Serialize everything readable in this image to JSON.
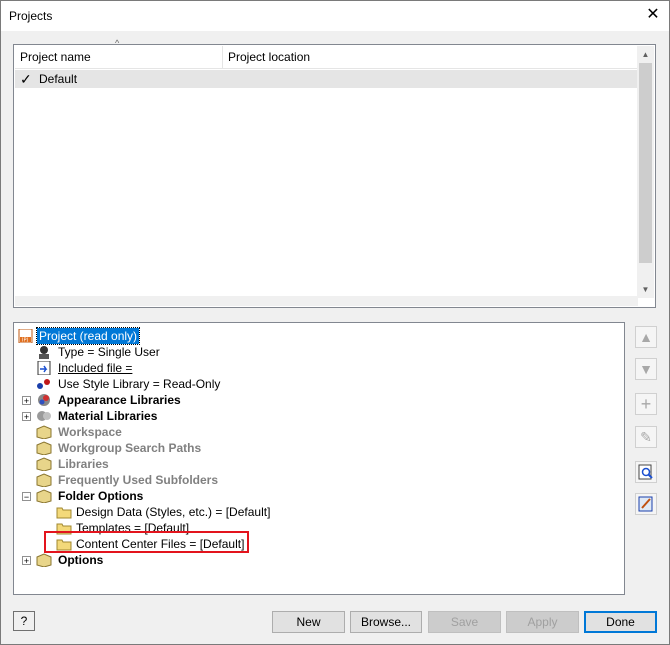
{
  "window": {
    "title": "Projects"
  },
  "project_list": {
    "columns": [
      "Project name",
      "Project location"
    ],
    "rows": [
      {
        "name": "Default",
        "location": "",
        "active": true
      }
    ]
  },
  "tree": {
    "root": "Project (read only)",
    "items": [
      {
        "label": "Type = Single User"
      },
      {
        "label": "Included file ="
      },
      {
        "label": "Use Style Library = Read-Only"
      },
      {
        "label": "Appearance Libraries"
      },
      {
        "label": "Material Libraries"
      },
      {
        "label": "Workspace"
      },
      {
        "label": "Workgroup Search Paths"
      },
      {
        "label": "Libraries"
      },
      {
        "label": "Frequently Used Subfolders"
      },
      {
        "label": "Folder Options"
      },
      {
        "label": "Design Data (Styles, etc.) = [Default]"
      },
      {
        "label": "Templates = [Default]"
      },
      {
        "label": "Content Center Files = [Default]"
      },
      {
        "label": "Options"
      }
    ]
  },
  "buttons": {
    "new": "New",
    "browse": "Browse...",
    "save": "Save",
    "apply": "Apply",
    "done": "Done",
    "help": "?"
  },
  "icons": {
    "close": "close-icon",
    "check": "checkmark-icon",
    "up": "move-up-icon",
    "down": "move-down-icon",
    "add": "add-icon",
    "edit": "edit-icon",
    "find": "find-icon",
    "edit_file": "edit-file-icon"
  },
  "colors": {
    "highlight": "#0078d7",
    "annotation": "#e3141d"
  }
}
